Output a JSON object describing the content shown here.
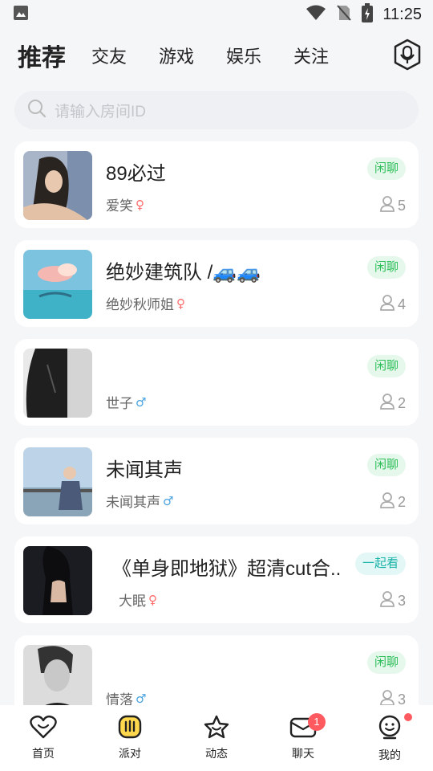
{
  "status_bar": {
    "time": "11:25"
  },
  "nav": {
    "tabs": [
      "推荐",
      "交友",
      "游戏",
      "娱乐",
      "关注"
    ]
  },
  "search": {
    "placeholder": "请输入房间ID"
  },
  "rooms": [
    {
      "title": " 89必过",
      "owner": "爱笑",
      "gender": "♀",
      "tag": "闲聊",
      "members": "5"
    },
    {
      "title": "绝妙建筑队 /🚙🚙",
      "owner": "绝妙秋师姐",
      "gender": "♀",
      "tag": "闲聊",
      "members": "4"
    },
    {
      "title": "",
      "owner": "世子",
      "gender": "♂",
      "tag": "闲聊",
      "members": "2"
    },
    {
      "title": "未闻其声",
      "owner": "未闻其声",
      "gender": "♂",
      "tag": "闲聊",
      "members": "2"
    },
    {
      "title": "《单身即地狱》超清cut合..",
      "owner": "大眠",
      "gender": "♀",
      "tag": "一起看",
      "members": "3"
    },
    {
      "title": "",
      "owner": "情落",
      "gender": "♂",
      "tag": "闲聊",
      "members": "3"
    }
  ],
  "tabbar": {
    "items": [
      {
        "label": "首页",
        "icon": "heart-home-icon"
      },
      {
        "label": "派对",
        "icon": "party-icon"
      },
      {
        "label": "动态",
        "icon": "star-moments-icon"
      },
      {
        "label": "聊天",
        "icon": "envelope-chat-icon",
        "badge": "1"
      },
      {
        "label": "我的",
        "icon": "smile-profile-icon"
      }
    ]
  },
  "colors": {
    "chat_tag": "#2fbf5a",
    "watch_tag": "#18b3a8",
    "female": "#ff6b6b",
    "male": "#4aa3e0",
    "badge": "#ff5a5f",
    "party_yellow": "#ffd84d"
  }
}
